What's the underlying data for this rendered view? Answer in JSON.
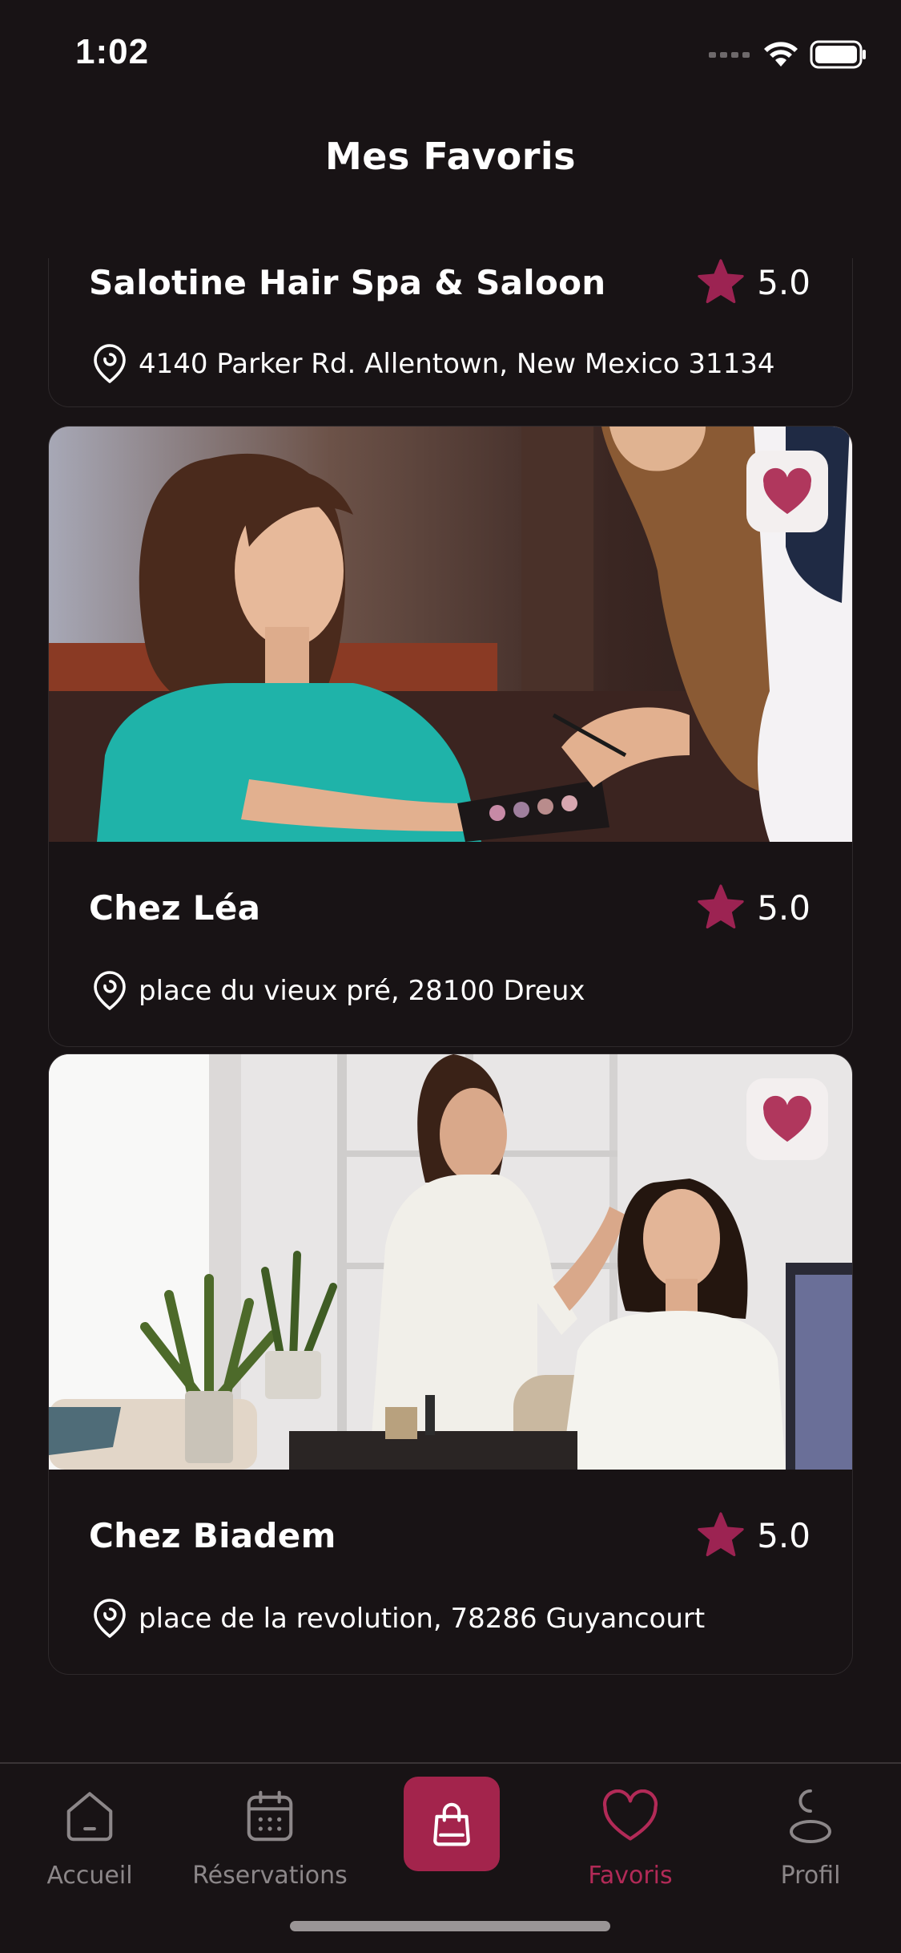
{
  "status": {
    "time": "1:02"
  },
  "header": {
    "title": "Mes Favoris"
  },
  "favorites": [
    {
      "name": "Salotine Hair Spa & Saloon",
      "rating": "5.0",
      "address": "4140 Parker Rd. Allentown, New Mexico 31134"
    },
    {
      "name": "Chez Léa",
      "rating": "5.0",
      "address": "place du vieux pré, 28100 Dreux"
    },
    {
      "name": "Chez Biadem",
      "rating": "5.0",
      "address": "place de la revolution, 78286 Guyancourt"
    }
  ],
  "tabbar": {
    "items": [
      {
        "label": "Accueil",
        "icon": "home-icon",
        "active": false
      },
      {
        "label": "Réservations",
        "icon": "calendar-icon",
        "active": false
      },
      {
        "label": "",
        "icon": "shopping-bag-icon",
        "active": false
      },
      {
        "label": "Favoris",
        "icon": "heart-icon",
        "active": true
      },
      {
        "label": "Profil",
        "icon": "profile-icon",
        "active": false
      }
    ]
  },
  "colors": {
    "background": "#181315",
    "accent": "#a3244c",
    "star": "#9c2352",
    "heart": "#b0375d",
    "inactive": "#8c8789"
  }
}
